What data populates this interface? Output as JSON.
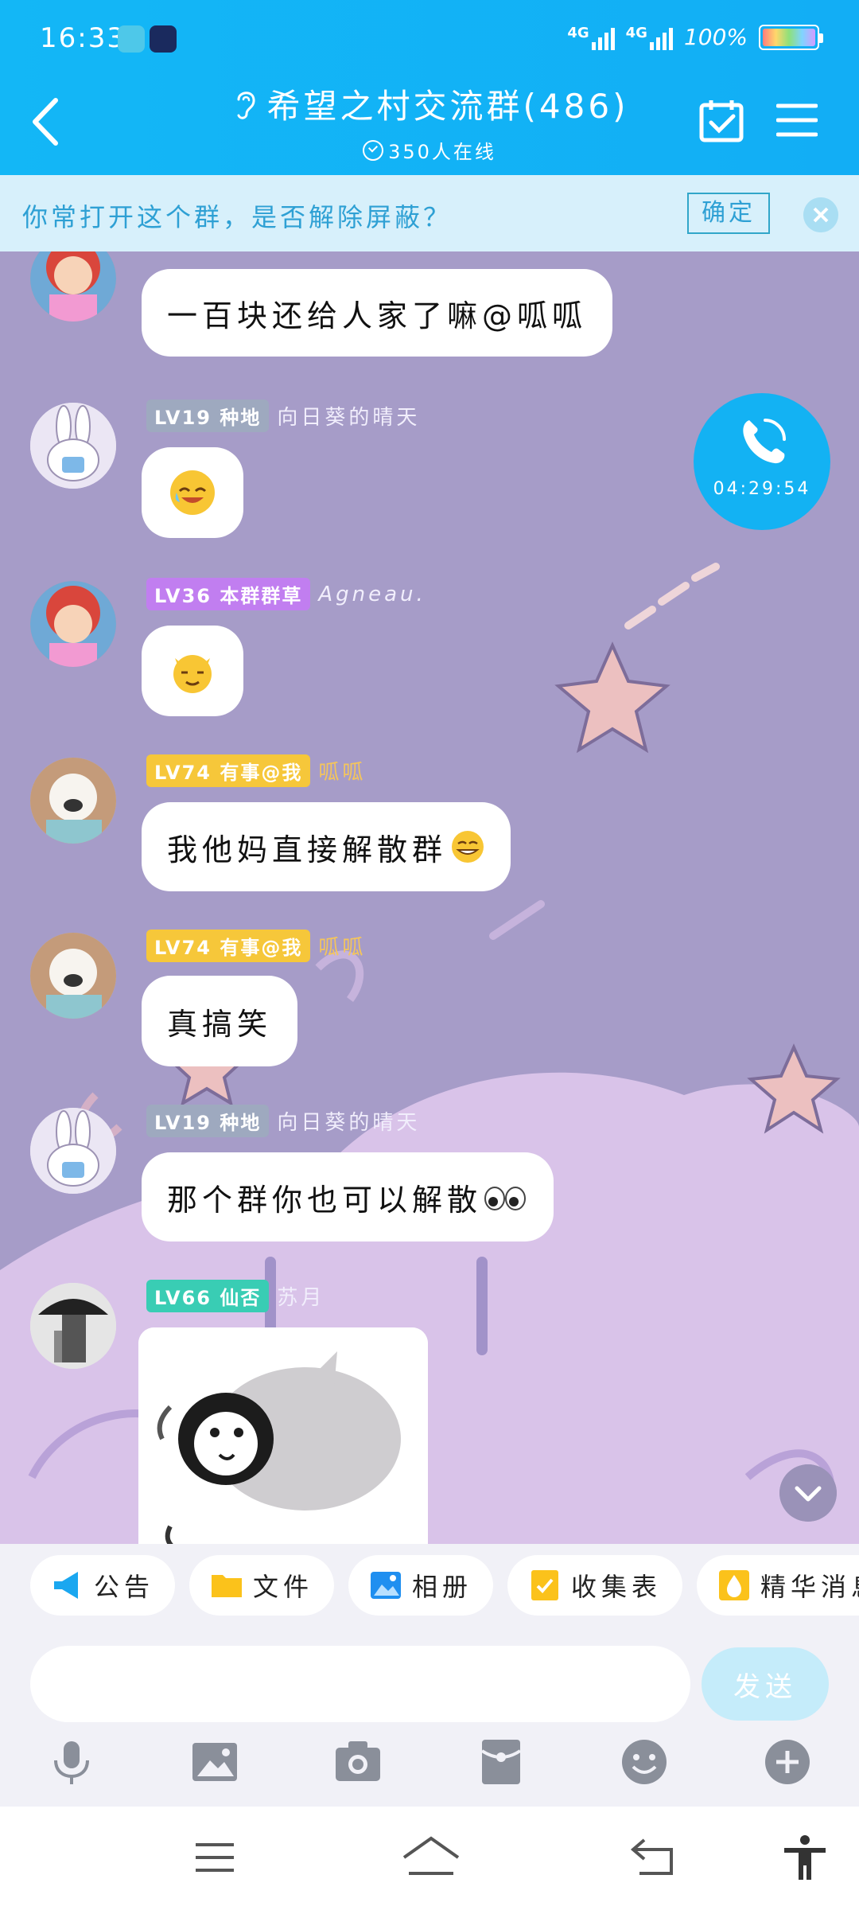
{
  "status_bar": {
    "time": "16:33",
    "network_1": "4G",
    "network_2": "4G",
    "battery": "100%"
  },
  "header": {
    "title": "希望之村交流群(486)",
    "online": "350人在线"
  },
  "banner": {
    "text": "你常打开这个群，是否解除屏蔽？",
    "confirm": "确定"
  },
  "call": {
    "duration": "04:29:54"
  },
  "messages": [
    {
      "text": "一百块还给人家了嘛@呱呱"
    },
    {
      "level": "LV19",
      "title": "种地",
      "nick": "向日葵的晴天",
      "badge_color": "#9ea9bf",
      "emoji": "laughing-crying-emoji"
    },
    {
      "level": "LV36",
      "title": "本群群草",
      "nick": "Agneau.",
      "badge_color": "#c17ef0",
      "emoji": "smug-cat-emoji"
    },
    {
      "level": "LV74",
      "title": "有事@我",
      "nick": "呱呱",
      "badge_color": "#f6c73a",
      "text": "我他妈直接解散群"
    },
    {
      "level": "LV74",
      "title": "有事@我",
      "nick": "呱呱",
      "badge_color": "#f6c73a",
      "text": "真搞笑"
    },
    {
      "level": "LV19",
      "title": "种地",
      "nick": "向日葵的晴天",
      "badge_color": "#9ea9bf",
      "text": "那个群你也可以解散"
    },
    {
      "level": "LV66",
      "title": "仙否",
      "nick": "苏月",
      "badge_color": "#39cdb4",
      "image": "penguin-sticker"
    }
  ],
  "toolbar": {
    "announcement": "公告",
    "files": "文件",
    "album": "相册",
    "collection": "收集表",
    "essence": "精华消息"
  },
  "input": {
    "placeholder": "",
    "send": "发送"
  },
  "colors": {
    "accent": "#13b2f3",
    "chat_bg": "#a79dc8"
  }
}
